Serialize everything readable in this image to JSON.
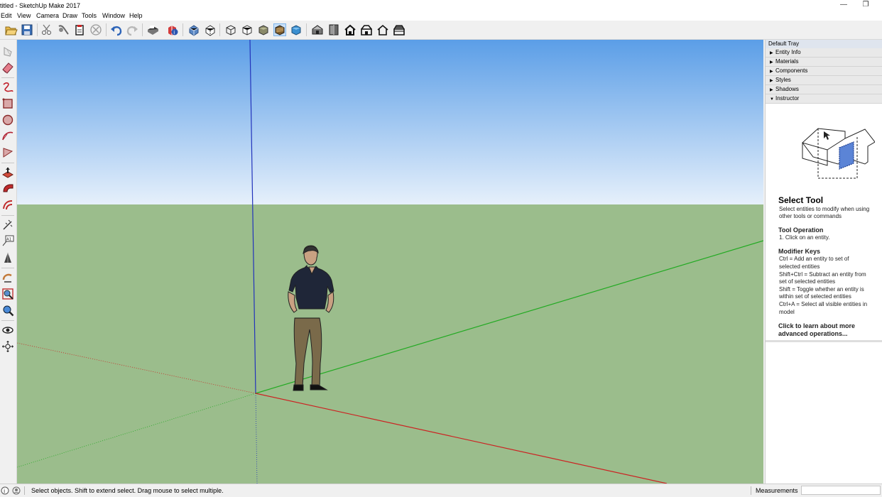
{
  "window": {
    "title": "titled - SketchUp Make 2017",
    "minimize_glyph": "—",
    "restore_glyph": "❐"
  },
  "menu": {
    "items": [
      "Edit",
      "View",
      "Camera",
      "Draw",
      "Tools",
      "Window",
      "Help"
    ]
  },
  "toolbar": {
    "icons": [
      "open-icon",
      "save-icon",
      "cut-icon",
      "copy-icon",
      "paste-icon",
      "erase-icon",
      "undo-icon",
      "redo-icon",
      "print-icon",
      "model-info-icon",
      "xray-icon",
      "back-edges-icon",
      "wireframe-icon",
      "hidden-line-icon",
      "shaded-icon",
      "shaded-textures-icon",
      "monochrome-icon",
      "iso-view-icon",
      "top-view-icon",
      "front-view-icon",
      "right-view-icon",
      "back-view-icon",
      "left-view-icon"
    ],
    "selected": "shaded-textures-icon"
  },
  "left_toolbar": {
    "icons": [
      "select-icon",
      "eraser-icon",
      "freehand-icon",
      "rectangle-icon",
      "circle-icon",
      "arc-icon",
      "polygon-icon",
      "push-pull-icon",
      "follow-me-icon",
      "offset-icon",
      "tape-measure-icon",
      "text-icon",
      "axes-icon",
      "orbit-icon",
      "zoom-icon",
      "zoom-window-icon",
      "walk-icon",
      "position-camera-icon"
    ],
    "text_icon_label": "A1"
  },
  "tray": {
    "title": "Default Tray",
    "panels": [
      {
        "label": "Entity Info",
        "expanded": false
      },
      {
        "label": "Materials",
        "expanded": false
      },
      {
        "label": "Components",
        "expanded": false
      },
      {
        "label": "Styles",
        "expanded": false
      },
      {
        "label": "Shadows",
        "expanded": false
      },
      {
        "label": "Instructor",
        "expanded": true
      }
    ],
    "instructor": {
      "tool_name": "Select Tool",
      "description_lines": [
        "Select entities to modify when using",
        "other tools or commands"
      ],
      "operation_heading": "Tool Operation",
      "operation_lines": [
        "1. Click on an entity."
      ],
      "modifier_heading": "Modifier Keys",
      "modifier_lines": [
        "Ctrl = Add an entity to set of",
        "selected entities",
        "Shift+Ctrl = Subtract an entity from",
        "set of selected entities",
        "Shift = Toggle whether an entity is",
        "within set of selected entities",
        "Ctrl+A = Select all visible entities in",
        "model"
      ],
      "learn_more_lines": [
        "Click to learn about more",
        "advanced operations..."
      ]
    }
  },
  "status": {
    "text": "Select objects. Shift to extend select. Drag mouse to select multiple.",
    "measurements_label": "Measurements",
    "measurements_value": ""
  },
  "colors": {
    "sky_top": "#5b9ee7",
    "sky_bottom": "#e6f0fb",
    "ground": "#9bbd8c",
    "axis_red": "#cc2222",
    "axis_green": "#22aa22",
    "axis_blue": "#2233bb",
    "selected_tool": "#c9e0f7"
  }
}
